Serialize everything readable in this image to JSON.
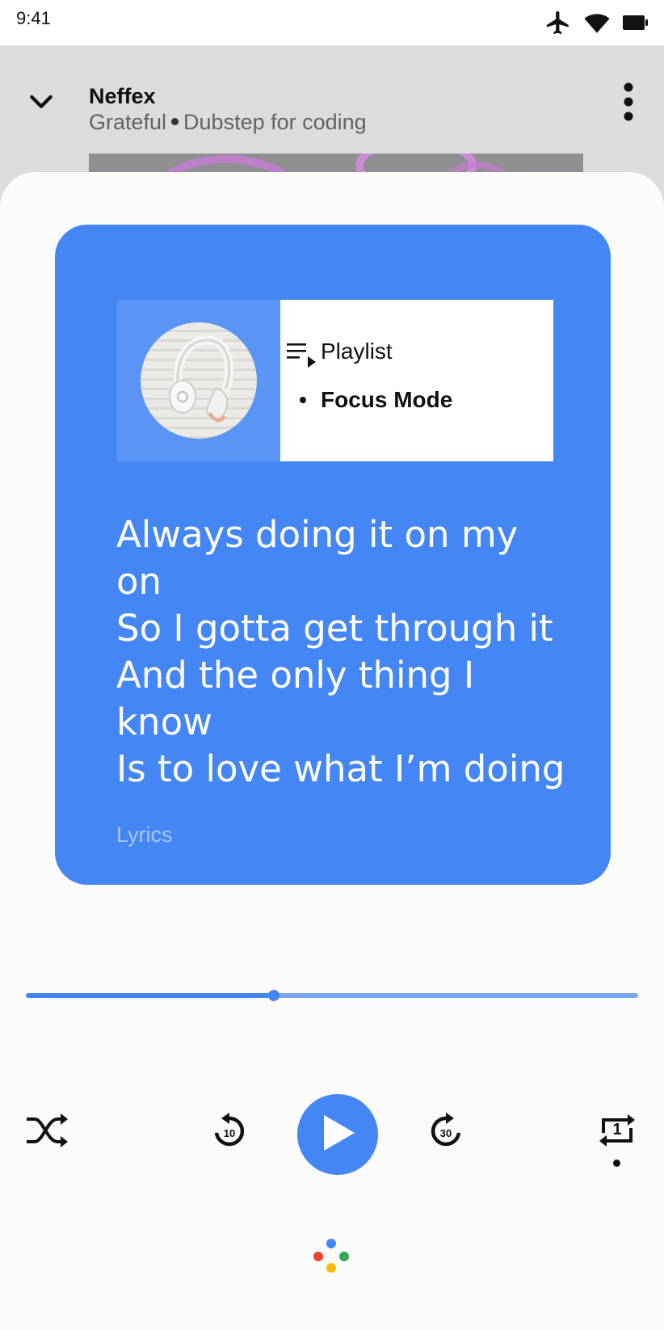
{
  "status_bar": {
    "time": "9:41",
    "icons": [
      "airplane-icon",
      "wifi-icon",
      "battery-icon"
    ]
  },
  "header": {
    "artist": "Neffex",
    "album": "Grateful",
    "playlist": "Dubstep for coding",
    "collapse_icon": "chevron-down-icon",
    "more_icon": "more-vert-icon"
  },
  "card": {
    "playlist_label": "Playlist",
    "playlist_name": "Focus Mode",
    "lyrics": [
      "Always doing it on my on",
      "So I gotta get through it",
      "And the only thing I know",
      "Is to love what I’m doing"
    ],
    "lyrics_label": "Lyrics"
  },
  "player": {
    "progress": 0.405,
    "rewind_seconds": "10",
    "forward_seconds": "30",
    "repeat_count": "1"
  },
  "colors": {
    "accent": "#4486f4",
    "header_bg": "#dcdcdc",
    "sheet_bg": "#fbfbf9"
  }
}
